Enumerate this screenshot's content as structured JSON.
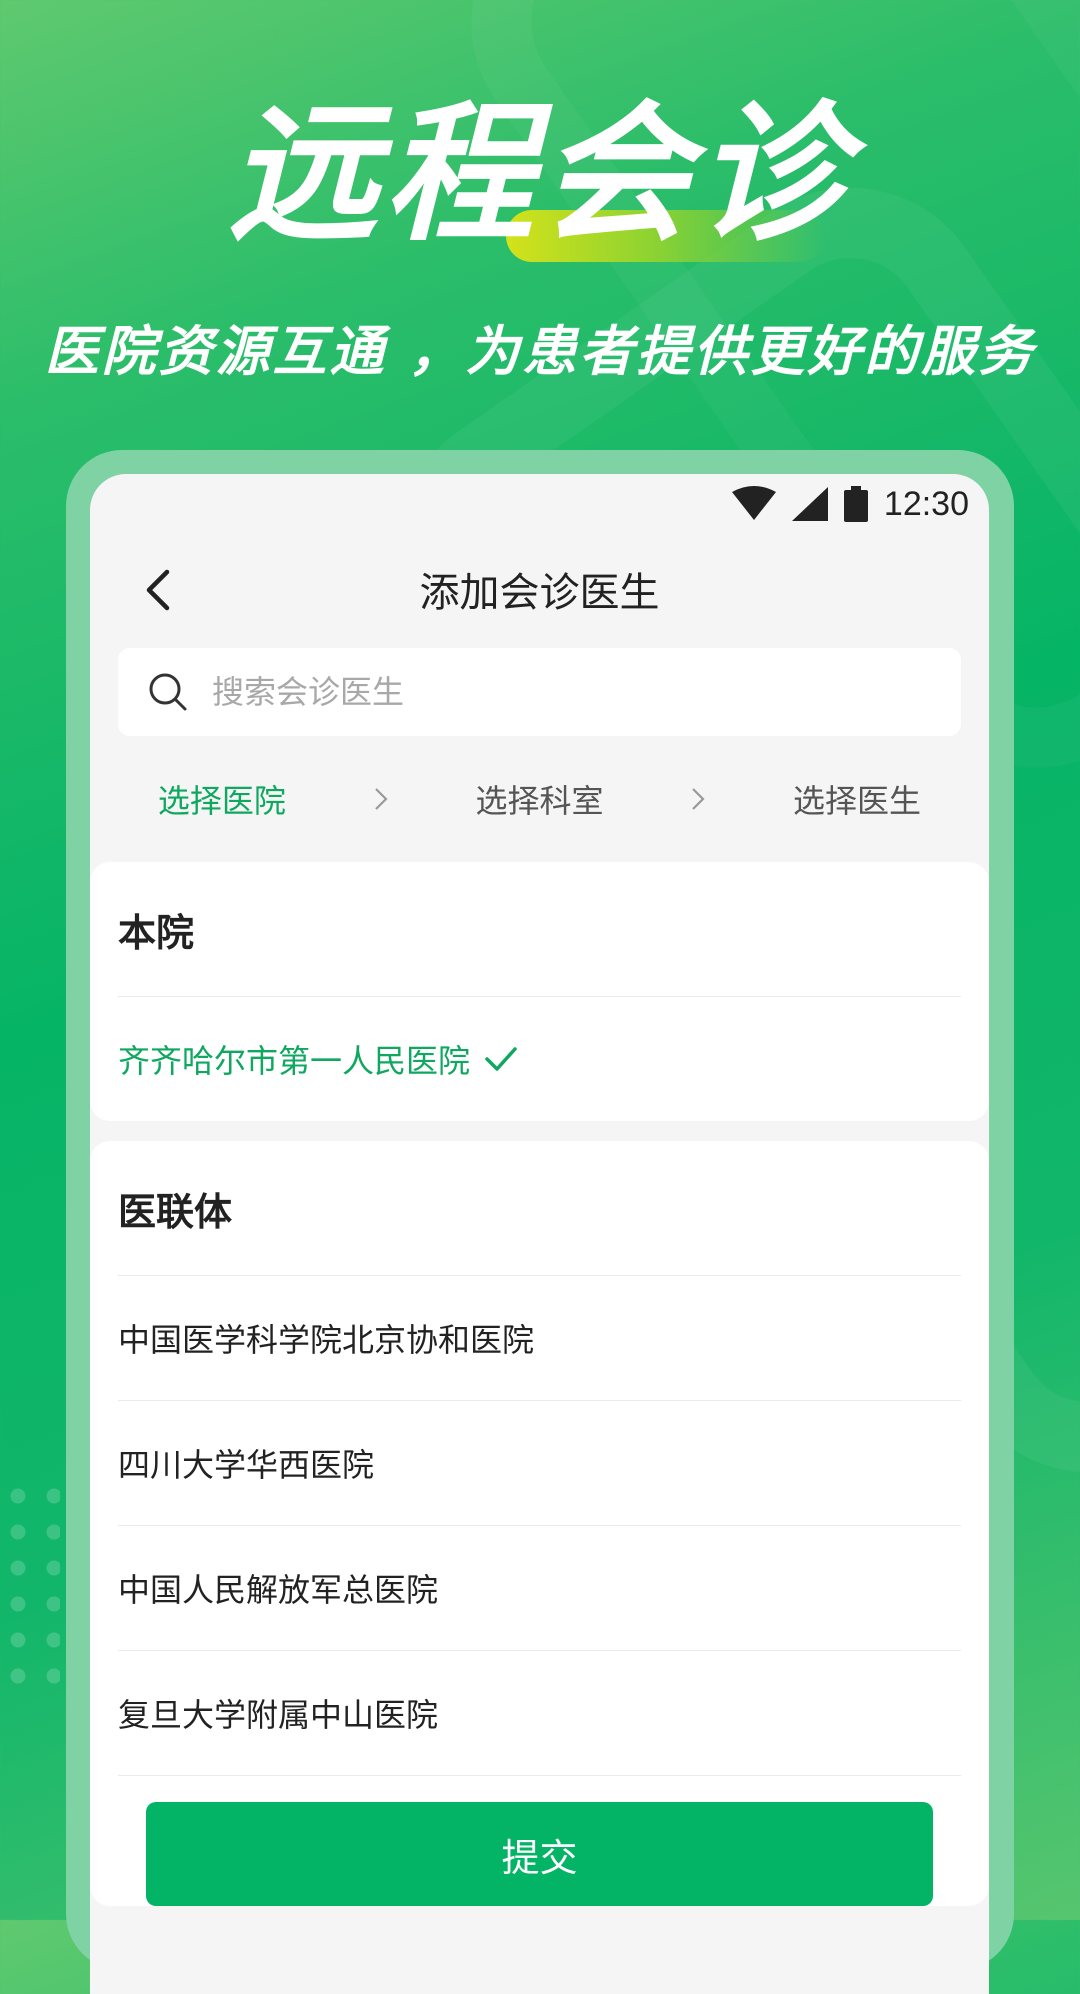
{
  "hero": {
    "title": "远程会诊",
    "subtitle": "医院资源互通 ，为患者提供更好的服务"
  },
  "status_bar": {
    "time": "12:30",
    "icons": [
      "wifi-icon",
      "signal-icon",
      "battery-icon"
    ]
  },
  "nav": {
    "title": "添加会诊医生",
    "back_icon": "chevron-left-icon"
  },
  "search": {
    "placeholder": "搜索会诊医生",
    "value": ""
  },
  "steps": [
    {
      "label": "选择医院",
      "active": true
    },
    {
      "label": "选择科室",
      "active": false
    },
    {
      "label": "选择医生",
      "active": false
    }
  ],
  "own_hospital": {
    "title": "本院",
    "items": [
      {
        "name": "齐齐哈尔市第一人民医院",
        "selected": true
      }
    ]
  },
  "alliance": {
    "title": "医联体",
    "items": [
      {
        "name": "中国医学科学院北京协和医院"
      },
      {
        "name": "四川大学华西医院"
      },
      {
        "name": "中国人民解放军总医院"
      },
      {
        "name": "复旦大学附属中山医院"
      }
    ]
  },
  "submit": {
    "label": "提交"
  },
  "colors": {
    "accent": "#04b466",
    "selected_text": "#10a860",
    "frame": "#7ed2a4"
  }
}
